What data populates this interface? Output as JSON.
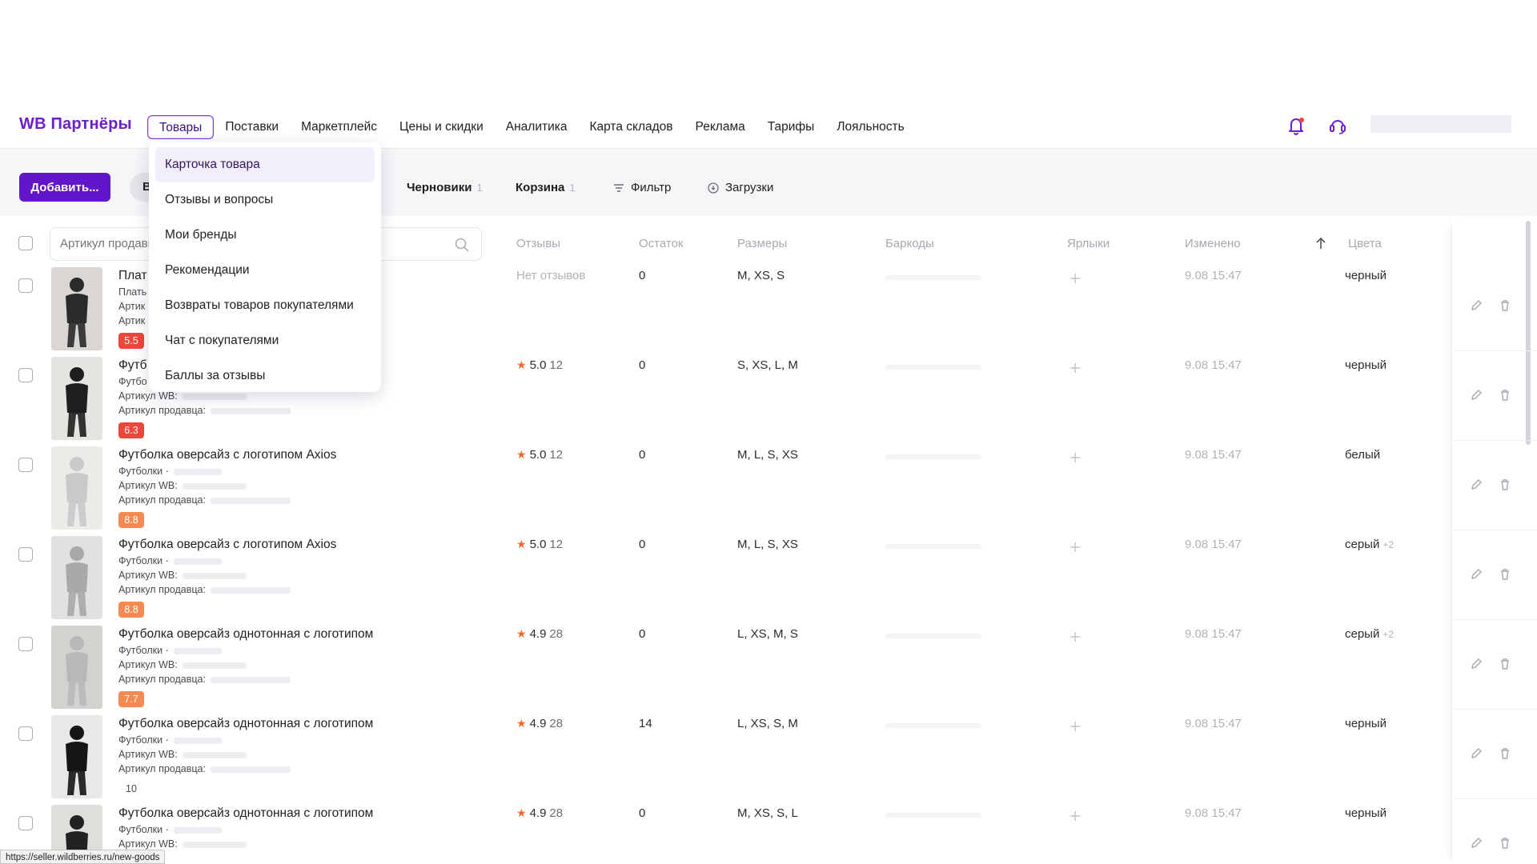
{
  "header": {
    "logo": "WB Партнёры",
    "nav": [
      "Товары",
      "Поставки",
      "Маркетплейс",
      "Цены и скидки",
      "Аналитика",
      "Карта складов",
      "Реклама",
      "Тарифы",
      "Лояльность"
    ],
    "active_nav": "Товары"
  },
  "toolbar": {
    "add_label": "Добавить...",
    "pill_label": "В",
    "drafts_label": "Черновики",
    "drafts_count": "1",
    "cart_label": "Корзина",
    "cart_count": "1",
    "filter_label": "Фильтр",
    "downloads_label": "Загрузки"
  },
  "dropdown": {
    "items": [
      "Карточка товара",
      "Отзывы и вопросы",
      "Мои бренды",
      "Рекомендации",
      "Возвраты товаров покупателями",
      "Чат с покупателями",
      "Баллы за отзывы"
    ]
  },
  "table": {
    "search_placeholder": "Артикул продавца",
    "columns": {
      "reviews": "Отзывы",
      "stock": "Остаток",
      "sizes": "Размеры",
      "barcodes": "Баркоды",
      "labels": "Ярлыки",
      "changed": "Изменено",
      "colors": "Цвета"
    },
    "rows": [
      {
        "title": "Плат",
        "meta1": "Плать",
        "meta2": "Артик",
        "meta3": "Артик",
        "rating": "5.5",
        "rating_color": "#f0453a",
        "reviews": "Нет отзывов",
        "stars": "",
        "review_count": "",
        "stock": "0",
        "sizes": "M, XS, S",
        "changed": "9.08 15:47",
        "color": "черный",
        "color_extra": ""
      },
      {
        "title": "Футб",
        "meta1": "Футбо",
        "meta2": "Артикул WB:",
        "meta3": "Артикул продавца:",
        "rating": "6.3",
        "rating_color": "#f0453a",
        "reviews": "",
        "stars": "5.0",
        "review_count": "12",
        "stock": "0",
        "sizes": "S, XS, L, M",
        "changed": "9.08 15:47",
        "color": "черный",
        "color_extra": ""
      },
      {
        "title": "Футболка оверсайз с логотипом Axios",
        "meta1": "Футболки ·",
        "meta2": "Артикул WB:",
        "meta3": "Артикул продавца:",
        "rating": "8.8",
        "rating_color": "#f58a53",
        "reviews": "",
        "stars": "5.0",
        "review_count": "12",
        "stock": "0",
        "sizes": "M, L, S, XS",
        "changed": "9.08 15:47",
        "color": "белый",
        "color_extra": ""
      },
      {
        "title": "Футболка оверсайз с логотипом Axios",
        "meta1": "Футболки ·",
        "meta2": "Артикул WB:",
        "meta3": "Артикул продавца:",
        "rating": "8.8",
        "rating_color": "#f58a53",
        "reviews": "",
        "stars": "5.0",
        "review_count": "12",
        "stock": "0",
        "sizes": "M, L, S, XS",
        "changed": "9.08 15:47",
        "color": "серый",
        "color_extra": "+2"
      },
      {
        "title": "Футболка оверсайз однотонная с логотипом",
        "meta1": "Футболки ·",
        "meta2": "Артикул WB:",
        "meta3": "Артикул продавца:",
        "rating": "7.7",
        "rating_color": "#f58a53",
        "reviews": "",
        "stars": "4.9",
        "review_count": "28",
        "stock": "0",
        "sizes": "L, XS, M, S",
        "changed": "9.08 15:47",
        "color": "серый",
        "color_extra": "+2"
      },
      {
        "title": "Футболка оверсайз однотонная с логотипом",
        "meta1": "Футболки ·",
        "meta2": "Артикул WB:",
        "meta3": "Артикул продавца:",
        "rating": "10",
        "rating_color": "",
        "reviews": "",
        "stars": "4.9",
        "review_count": "28",
        "stock": "14",
        "sizes": "L, XS, S, M",
        "changed": "9.08 15:47",
        "color": "черный",
        "color_extra": ""
      },
      {
        "title": "Футболка оверсайз однотонная с логотипом",
        "meta1": "Футболки ·",
        "meta2": "Артикул WB:",
        "meta3": "",
        "rating": "",
        "rating_color": "",
        "reviews": "",
        "stars": "4.9",
        "review_count": "28",
        "stock": "0",
        "sizes": "M, XS, S, L",
        "changed": "9.08 15:47",
        "color": "черный",
        "color_extra": ""
      }
    ]
  },
  "status_url": "https://seller.wildberries.ru/new-goods",
  "colors": {
    "accent": "#6216c9",
    "brand": "#6b1fd1",
    "star": "#f06a2a"
  },
  "icons": [
    "bell-icon",
    "headset-icon",
    "search-icon",
    "filter-icon",
    "download-icon",
    "sort-arrow-icon",
    "plus-icon",
    "edit-icon",
    "trash-icon"
  ]
}
